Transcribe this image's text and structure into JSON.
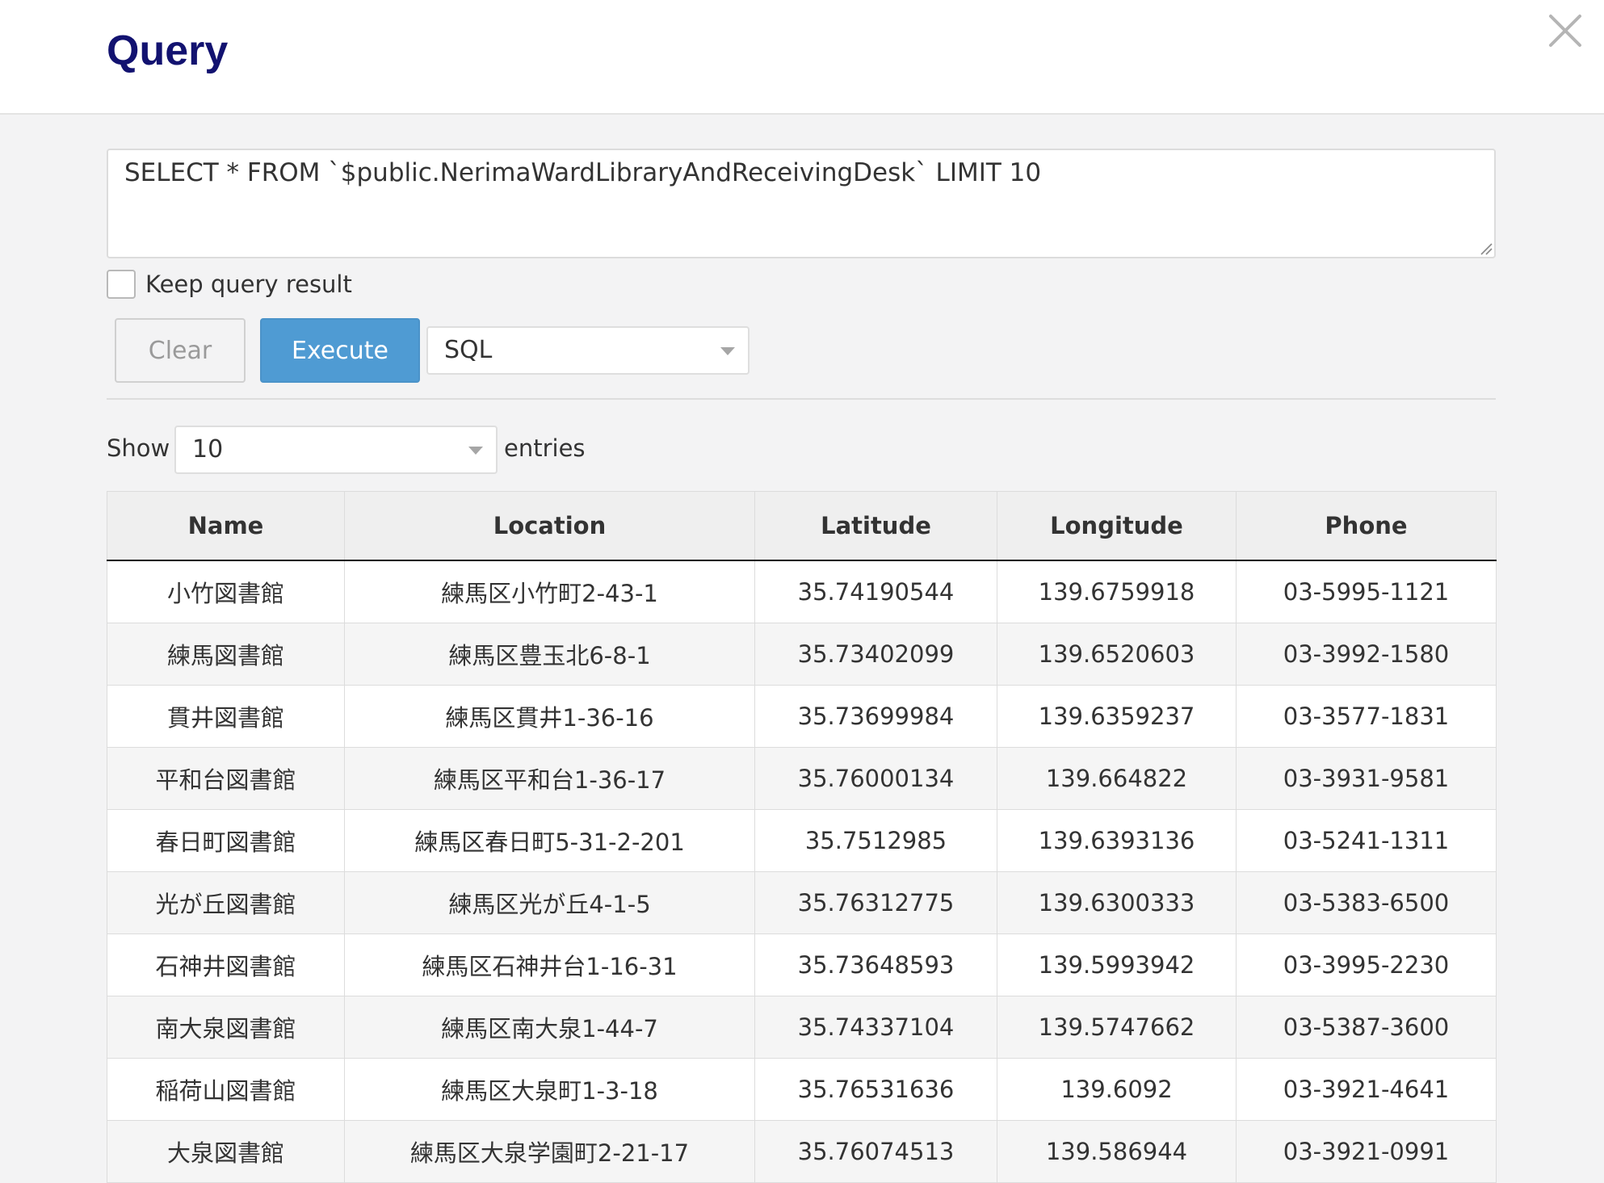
{
  "header": {
    "title": "Query"
  },
  "query": {
    "text": "SELECT * FROM `$public.NerimaWardLibraryAndReceivingDesk` LIMIT 10",
    "keep_label": "Keep query result"
  },
  "toolbar": {
    "clear_label": "Clear",
    "execute_label": "Execute",
    "language": "SQL"
  },
  "pagination": {
    "show_label": "Show",
    "entries_value": "10",
    "entries_label": "entries"
  },
  "table": {
    "columns": [
      "Name",
      "Location",
      "Latitude",
      "Longitude",
      "Phone"
    ],
    "rows": [
      [
        "小竹図書館",
        "練馬区小竹町2-43-1",
        "35.74190544",
        "139.6759918",
        "03-5995-1121"
      ],
      [
        "練馬図書館",
        "練馬区豊玉北6-8-1",
        "35.73402099",
        "139.6520603",
        "03-3992-1580"
      ],
      [
        "貫井図書館",
        "練馬区貫井1-36-16",
        "35.73699984",
        "139.6359237",
        "03-3577-1831"
      ],
      [
        "平和台図書館",
        "練馬区平和台1-36-17",
        "35.76000134",
        "139.664822",
        "03-3931-9581"
      ],
      [
        "春日町図書館",
        "練馬区春日町5-31-2-201",
        "35.7512985",
        "139.6393136",
        "03-5241-1311"
      ],
      [
        "光が丘図書館",
        "練馬区光が丘4-1-5",
        "35.76312775",
        "139.6300333",
        "03-5383-6500"
      ],
      [
        "石神井図書館",
        "練馬区石神井台1-16-31",
        "35.73648593",
        "139.5993942",
        "03-3995-2230"
      ],
      [
        "南大泉図書館",
        "練馬区南大泉1-44-7",
        "35.74337104",
        "139.5747662",
        "03-5387-3600"
      ],
      [
        "稲荷山図書館",
        "練馬区大泉町1-3-18",
        "35.76531636",
        "139.6092",
        "03-3921-4641"
      ],
      [
        "大泉図書館",
        "練馬区大泉学園町2-21-17",
        "35.76074513",
        "139.586944",
        "03-3921-0991"
      ]
    ]
  }
}
